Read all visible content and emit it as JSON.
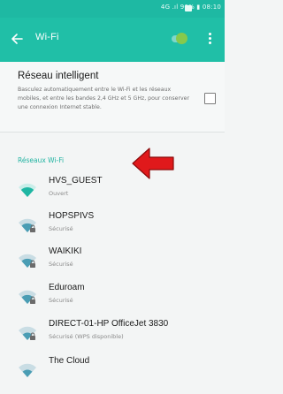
{
  "status_bar": {
    "indicators": "4G .ıl 96% ▮ 08:10",
    "background": "#1eb9a3"
  },
  "app_bar": {
    "title": "Wi-Fi",
    "toggle_on": true,
    "accent": "#20bfa7"
  },
  "smart_network": {
    "title": "Réseau intelligent",
    "description": "Basculez automatiquement entre le Wi-Fi et les réseaux mobiles, et entre les bandes 2,4 GHz et 5 GHz, pour conserver une connexion Internet stable.",
    "checked": false
  },
  "networks_section": {
    "title": "Réseaux Wi-Fi",
    "color": "#20b3a1",
    "items": [
      {
        "name": "HVS_GUEST",
        "status": "Ouvert",
        "secured": false,
        "signal_color": "#1fb6a3"
      },
      {
        "name": "HOPSPIVS",
        "status": "Sécurisé",
        "secured": true,
        "signal_color": "#4a9db4"
      },
      {
        "name": "WAIKIKI",
        "status": "Sécurisé",
        "secured": true,
        "signal_color": "#4a9db4"
      },
      {
        "name": "Eduroam",
        "status": "Sécurisé",
        "secured": true,
        "signal_color": "#4a9db4"
      },
      {
        "name": "DIRECT-01-HP OfficeJet 3830",
        "status": "Sécurisé (WPS disponible)",
        "secured": true,
        "signal_color": "#4a9db4"
      },
      {
        "name": "The Cloud",
        "status": "",
        "secured": false,
        "signal_color": "#4a9db4"
      }
    ]
  },
  "annotation": {
    "arrow_color": "#e0191b",
    "target": "HVS_GUEST"
  }
}
